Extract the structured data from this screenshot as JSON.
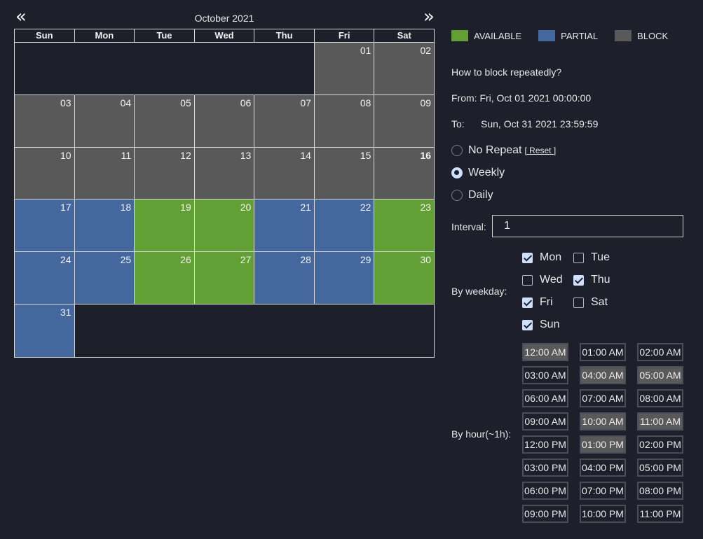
{
  "calendar": {
    "title": "October 2021",
    "prev_icon": "double-chevron-left-icon",
    "next_icon": "double-chevron-right-icon",
    "prev_glyph": "«",
    "next_glyph": "»",
    "weekdays": [
      "Sun",
      "Mon",
      "Tue",
      "Wed",
      "Thu",
      "Fri",
      "Sat"
    ],
    "weeks": [
      [
        null,
        null,
        null,
        null,
        null,
        {
          "day": "01",
          "status": "block"
        },
        {
          "day": "02",
          "status": "block"
        }
      ],
      [
        {
          "day": "03",
          "status": "block"
        },
        {
          "day": "04",
          "status": "block"
        },
        {
          "day": "05",
          "status": "block"
        },
        {
          "day": "06",
          "status": "block"
        },
        {
          "day": "07",
          "status": "block"
        },
        {
          "day": "08",
          "status": "block"
        },
        {
          "day": "09",
          "status": "block"
        }
      ],
      [
        {
          "day": "10",
          "status": "block"
        },
        {
          "day": "11",
          "status": "block"
        },
        {
          "day": "12",
          "status": "block"
        },
        {
          "day": "13",
          "status": "block"
        },
        {
          "day": "14",
          "status": "block"
        },
        {
          "day": "15",
          "status": "block"
        },
        {
          "day": "16",
          "status": "block",
          "today": true
        }
      ],
      [
        {
          "day": "17",
          "status": "partial"
        },
        {
          "day": "18",
          "status": "partial"
        },
        {
          "day": "19",
          "status": "available"
        },
        {
          "day": "20",
          "status": "available"
        },
        {
          "day": "21",
          "status": "partial"
        },
        {
          "day": "22",
          "status": "partial"
        },
        {
          "day": "23",
          "status": "available"
        }
      ],
      [
        {
          "day": "24",
          "status": "partial"
        },
        {
          "day": "25",
          "status": "partial"
        },
        {
          "day": "26",
          "status": "available"
        },
        {
          "day": "27",
          "status": "available"
        },
        {
          "day": "28",
          "status": "partial"
        },
        {
          "day": "29",
          "status": "partial"
        },
        {
          "day": "30",
          "status": "available"
        }
      ],
      [
        {
          "day": "31",
          "status": "partial"
        },
        null,
        null,
        null,
        null,
        null,
        null
      ]
    ]
  },
  "colors": {
    "available": "#62a035",
    "partial": "#44679e",
    "block": "#595959",
    "background": "#1d202b"
  },
  "legend": [
    {
      "label": "AVAILABLE",
      "status": "available"
    },
    {
      "label": "PARTIAL",
      "status": "partial"
    },
    {
      "label": "BLOCK",
      "status": "block"
    }
  ],
  "panel": {
    "question": "How to block repeatedly?",
    "from_text": "From: Fri, Oct 01 2021 00:00:00",
    "to_label": "To:",
    "to_value": "Sun, Oct 31 2021 23:59:59",
    "repeat_options": [
      {
        "label": "No Repeat",
        "checked": false
      },
      {
        "label": "Weekly",
        "checked": true
      },
      {
        "label": "Daily",
        "checked": false
      }
    ],
    "reset_label": "[ Reset ]",
    "interval_label": "Interval:",
    "interval_value": "1",
    "weekday_label": "By weekday:",
    "weekday_options": [
      {
        "label": "Mon",
        "checked": true
      },
      {
        "label": "Tue",
        "checked": false
      },
      {
        "label": "Wed",
        "checked": false
      },
      {
        "label": "Thu",
        "checked": true
      },
      {
        "label": "Fri",
        "checked": true
      },
      {
        "label": "Sat",
        "checked": false
      },
      {
        "label": "Sun",
        "checked": true
      }
    ],
    "hour_label": "By hour(~1h):",
    "hours": [
      {
        "label": "12:00 AM",
        "selected": true
      },
      {
        "label": "01:00 AM",
        "selected": false
      },
      {
        "label": "02:00 AM",
        "selected": false
      },
      {
        "label": "03:00 AM",
        "selected": false
      },
      {
        "label": "04:00 AM",
        "selected": true
      },
      {
        "label": "05:00 AM",
        "selected": true
      },
      {
        "label": "06:00 AM",
        "selected": false
      },
      {
        "label": "07:00 AM",
        "selected": false
      },
      {
        "label": "08:00 AM",
        "selected": false
      },
      {
        "label": "09:00 AM",
        "selected": false
      },
      {
        "label": "10:00 AM",
        "selected": true
      },
      {
        "label": "11:00 AM",
        "selected": true
      },
      {
        "label": "12:00 PM",
        "selected": false
      },
      {
        "label": "01:00 PM",
        "selected": true
      },
      {
        "label": "02:00 PM",
        "selected": false
      },
      {
        "label": "03:00 PM",
        "selected": false
      },
      {
        "label": "04:00 PM",
        "selected": false
      },
      {
        "label": "05:00 PM",
        "selected": false
      },
      {
        "label": "06:00 PM",
        "selected": false
      },
      {
        "label": "07:00 PM",
        "selected": false
      },
      {
        "label": "08:00 PM",
        "selected": false
      },
      {
        "label": "09:00 PM",
        "selected": false
      },
      {
        "label": "10:00 PM",
        "selected": false
      },
      {
        "label": "11:00 PM",
        "selected": false
      }
    ]
  }
}
